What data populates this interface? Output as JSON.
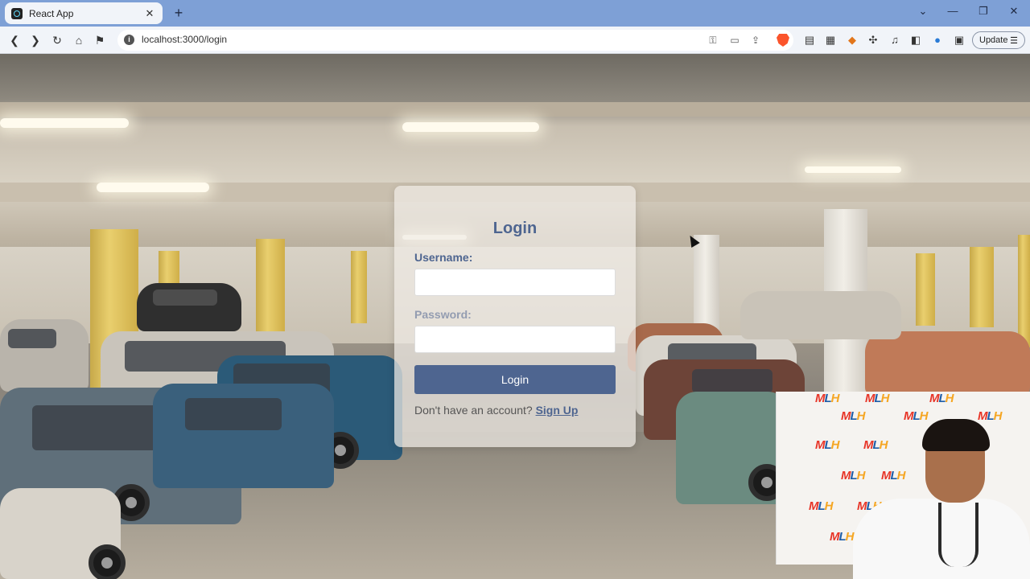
{
  "browser": {
    "tab_title": "React App",
    "tab_close": "✕",
    "new_tab": "+",
    "url": "localhost:3000/login",
    "update_label": "Update"
  },
  "login": {
    "title": "Login",
    "username_label": "Username:",
    "username_value": "",
    "password_label": "Password:",
    "password_value": "",
    "button_label": "Login",
    "signup_prompt": "Don't have an account?",
    "signup_link": "Sign Up"
  },
  "webcam": {
    "banner_text": "MLH"
  },
  "colors": {
    "accent": "#4e6590",
    "tabbar": "#7ea0d6"
  }
}
